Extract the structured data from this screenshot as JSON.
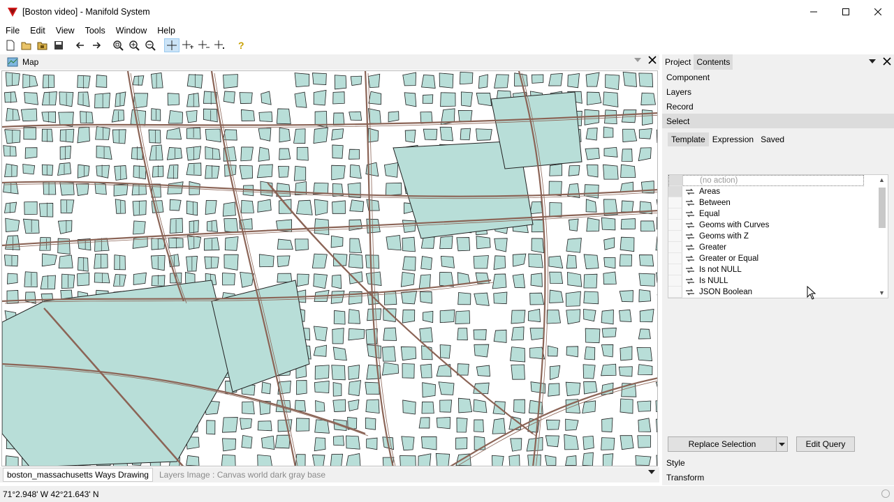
{
  "window": {
    "title": "[Boston video] - Manifold System",
    "controls": [
      "minimize",
      "maximize",
      "close"
    ]
  },
  "menu": [
    "File",
    "Edit",
    "View",
    "Tools",
    "Window",
    "Help"
  ],
  "map": {
    "tab_label": "Map",
    "colors": {
      "block_fill": "#b8ded8",
      "block_stroke": "#1f1f1f",
      "road": "#8b6456",
      "background": "#ffffff"
    }
  },
  "layers": {
    "active": "boston_massachusetts Ways Drawing",
    "inactive": "Layers Image : Canvas world dark gray base"
  },
  "status": {
    "coords": "71°2.948' W 42°21.643' N"
  },
  "pane": {
    "tabs": [
      "Project",
      "Contents"
    ],
    "sections_top": [
      "Component",
      "Layers",
      "Record",
      "Select"
    ],
    "select_subtabs": [
      "Template",
      "Expression",
      "Saved"
    ],
    "list_placeholder": "(no action)",
    "list_items": [
      "Areas",
      "Between",
      "Equal",
      "Geoms with Curves",
      "Geoms with Z",
      "Greater",
      "Greater or Equal",
      "Is not NULL",
      "Is NULL",
      "JSON Boolean"
    ],
    "replace_button": "Replace Selection",
    "edit_query_button": "Edit Query",
    "sections_bottom": [
      "Style",
      "Transform"
    ]
  }
}
